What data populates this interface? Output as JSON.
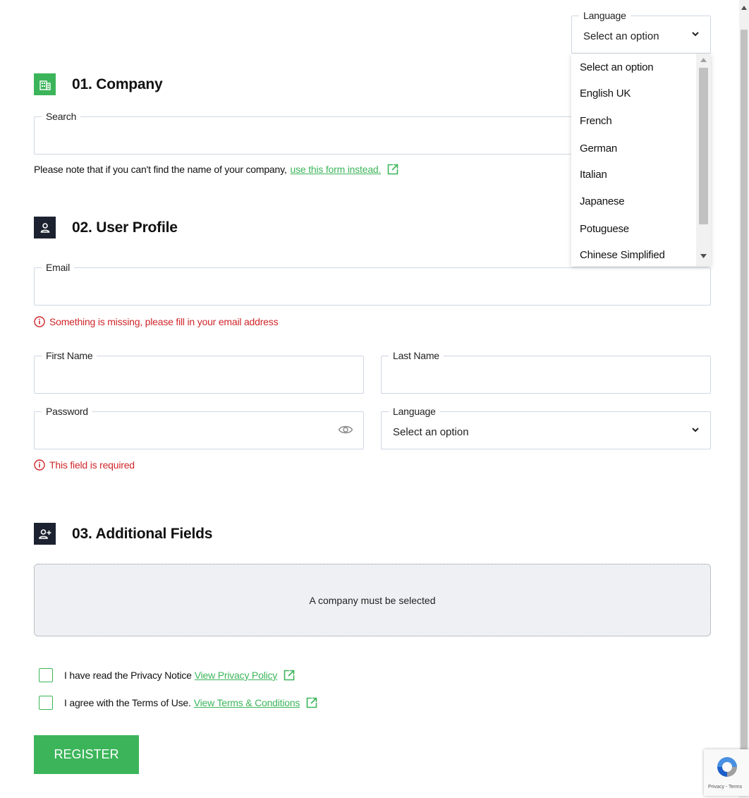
{
  "top_language": {
    "legend": "Language",
    "value": "Select an option"
  },
  "dropdown": {
    "options": [
      "Select an option",
      "English UK",
      "French",
      "German",
      "Italian",
      "Japanese",
      "Potuguese",
      "Chinese Simplified"
    ]
  },
  "company": {
    "title": "01. Company",
    "search_legend": "Search",
    "note_text": "Please note that if you can't find the name of your company,",
    "note_link": "use this form instead."
  },
  "user_profile": {
    "title": "02. User Profile",
    "email_legend": "Email",
    "email_error": "Something is missing, please fill in your email address",
    "first_name_legend": "First Name",
    "last_name_legend": "Last Name",
    "password_legend": "Password",
    "password_error": "This field is required",
    "language_legend": "Language",
    "language_value": "Select an option"
  },
  "additional": {
    "title": "03. Additional Fields",
    "placeholder": "A company must be selected"
  },
  "consents": {
    "privacy_text": "I have read the Privacy Notice",
    "privacy_link": "View Privacy Policy",
    "terms_text": "I agree with the Terms of Use.",
    "terms_link": "View Terms & Conditions"
  },
  "register_label": "REGISTER",
  "recaptcha_text": "Privacy - Terms",
  "colors": {
    "accent": "#3cb55a",
    "error": "#d0262a",
    "dark": "#1c2230"
  }
}
